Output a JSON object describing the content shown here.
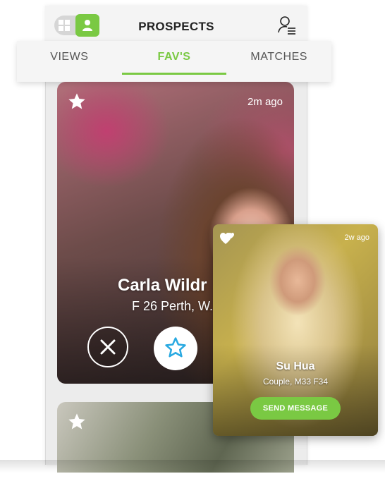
{
  "header": {
    "title": "PROSPECTS",
    "view_toggle": {
      "grid_icon": "grid-icon",
      "user_icon": "user-icon",
      "active": "user"
    },
    "filter_icon": "user-filter-icon"
  },
  "tabs": [
    {
      "label": "VIEWS",
      "active": false
    },
    {
      "label": "FAV'S",
      "active": true
    },
    {
      "label": "MATCHES",
      "active": false
    }
  ],
  "profile_card": {
    "time_ago": "2m ago",
    "name": "Carla Wildr",
    "details": "F 26 Perth, W.",
    "favorite_icon": "star-icon",
    "reject_icon": "close-icon",
    "fav_icon": "star-outline-icon"
  },
  "next_card": {
    "favorite_icon": "star-icon"
  },
  "match_popup": {
    "time_ago": "2w ago",
    "name": "Su Hua",
    "details": "Couple, M33 F34",
    "send_label": "SEND MESSAGE",
    "heart_icon": "hearts-icon"
  },
  "colors": {
    "accent": "#7ac943",
    "fav_blue": "#29a9e1"
  }
}
